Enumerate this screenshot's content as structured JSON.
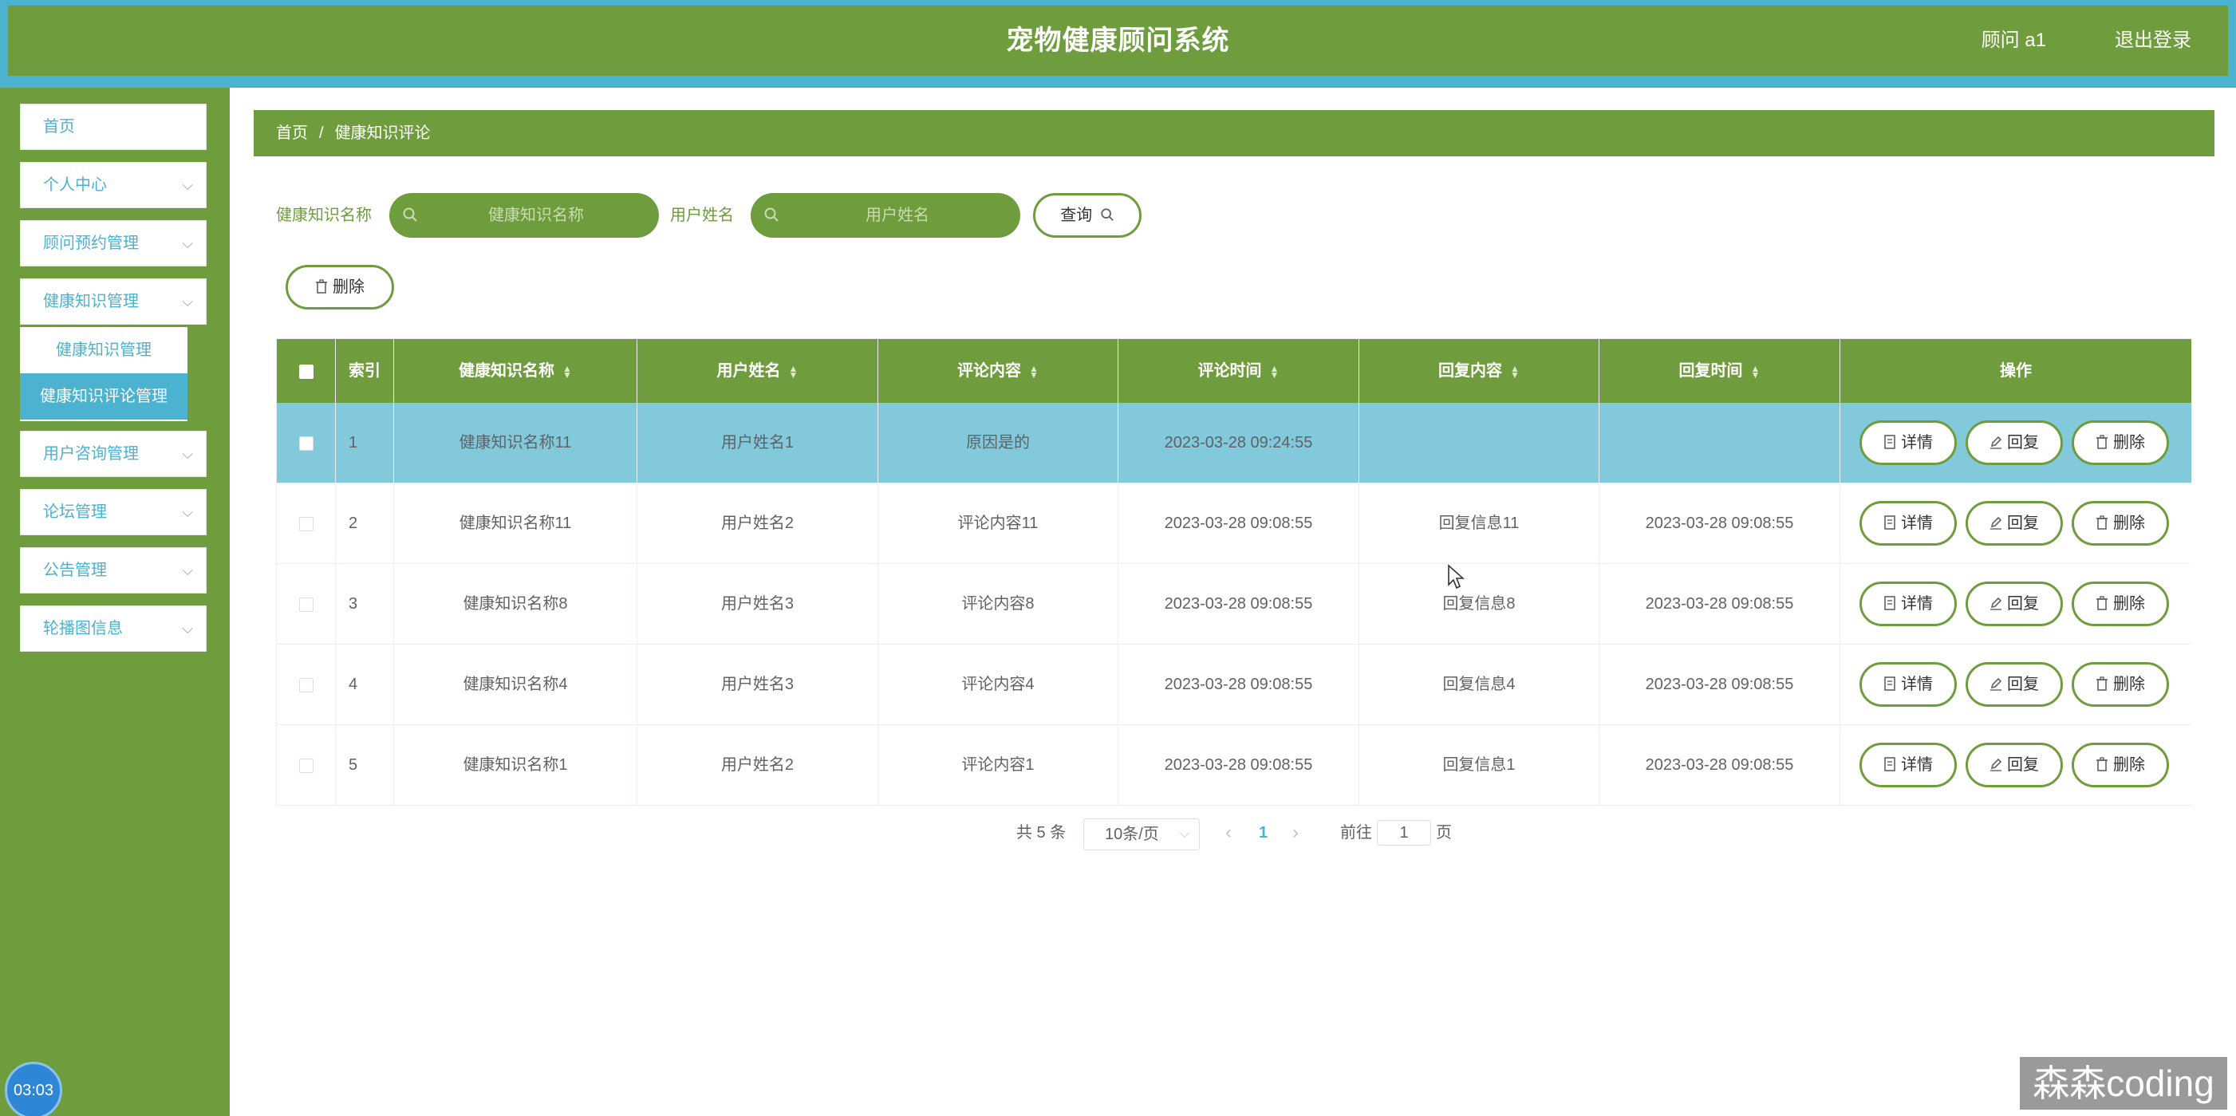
{
  "header": {
    "title": "宠物健康顾问系统",
    "user": "顾问 a1",
    "logout": "退出登录"
  },
  "sidebar": {
    "items": [
      {
        "label": "首页"
      },
      {
        "label": "个人中心"
      },
      {
        "label": "顾问预约管理"
      },
      {
        "label": "健康知识管理"
      },
      {
        "label": "用户咨询管理"
      },
      {
        "label": "论坛管理"
      },
      {
        "label": "公告管理"
      },
      {
        "label": "轮播图信息"
      }
    ],
    "submenu": [
      {
        "label": "健康知识管理"
      },
      {
        "label": "健康知识评论管理"
      }
    ]
  },
  "clock": "03:03",
  "breadcrumb": {
    "home": "首页",
    "sep": "/",
    "current": "健康知识评论"
  },
  "search": {
    "name_label": "健康知识名称",
    "name_placeholder": "健康知识名称",
    "user_label": "用户姓名",
    "user_placeholder": "用户姓名",
    "query_button": "查询"
  },
  "toolbar": {
    "delete_button": "删除"
  },
  "table": {
    "headers": [
      "索引",
      "健康知识名称",
      "用户姓名",
      "评论内容",
      "评论时间",
      "回复内容",
      "回复时间",
      "操作"
    ],
    "rows": [
      {
        "index": "1",
        "name": "健康知识名称11",
        "user": "用户姓名1",
        "comment": "原因是的",
        "time": "2023-03-28 09:24:55",
        "reply": "",
        "reply_time": ""
      },
      {
        "index": "2",
        "name": "健康知识名称11",
        "user": "用户姓名2",
        "comment": "评论内容11",
        "time": "2023-03-28 09:08:55",
        "reply": "回复信息11",
        "reply_time": "2023-03-28 09:08:55"
      },
      {
        "index": "3",
        "name": "健康知识名称8",
        "user": "用户姓名3",
        "comment": "评论内容8",
        "time": "2023-03-28 09:08:55",
        "reply": "回复信息8",
        "reply_time": "2023-03-28 09:08:55"
      },
      {
        "index": "4",
        "name": "健康知识名称4",
        "user": "用户姓名3",
        "comment": "评论内容4",
        "time": "2023-03-28 09:08:55",
        "reply": "回复信息4",
        "reply_time": "2023-03-28 09:08:55"
      },
      {
        "index": "5",
        "name": "健康知识名称1",
        "user": "用户姓名2",
        "comment": "评论内容1",
        "time": "2023-03-28 09:08:55",
        "reply": "回复信息1",
        "reply_time": "2023-03-28 09:08:55"
      }
    ],
    "actions": {
      "detail": "详情",
      "reply": "回复",
      "delete": "删除"
    }
  },
  "pagination": {
    "total": "共 5 条",
    "page_size": "10条/页",
    "current": "1",
    "goto_label": "前往",
    "goto_value": "1",
    "page_suffix": "页"
  },
  "watermark": "森森coding",
  "colors": {
    "primary": "#6f9c3c",
    "accent": "#4bb3cf",
    "highlight_row": "#82c9dc"
  }
}
